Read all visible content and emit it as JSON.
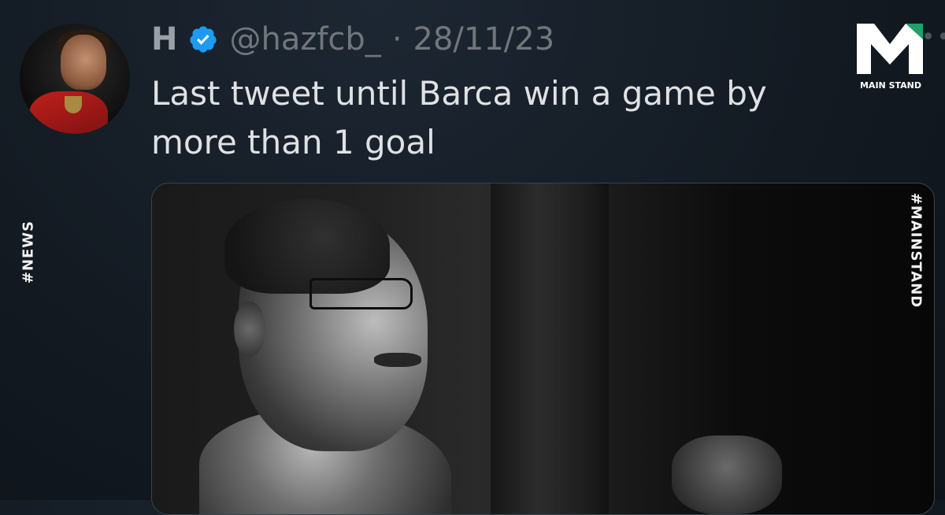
{
  "tweet": {
    "display_name": "H",
    "verified_icon": "verified-badge-icon",
    "handle": "@hazfcb_",
    "separator": "·",
    "date": "28/11/23",
    "text": "Last tweet until Barca win a game by more than 1 goal",
    "more_icon": "more-dots-icon"
  },
  "overlay": {
    "left_tag": "#NEWS",
    "right_tag": "#MAINSTAND",
    "logo_caption": "MAIN STAND"
  },
  "colors": {
    "verified": "#1d9bf0",
    "logo_green": "#22a06b"
  }
}
